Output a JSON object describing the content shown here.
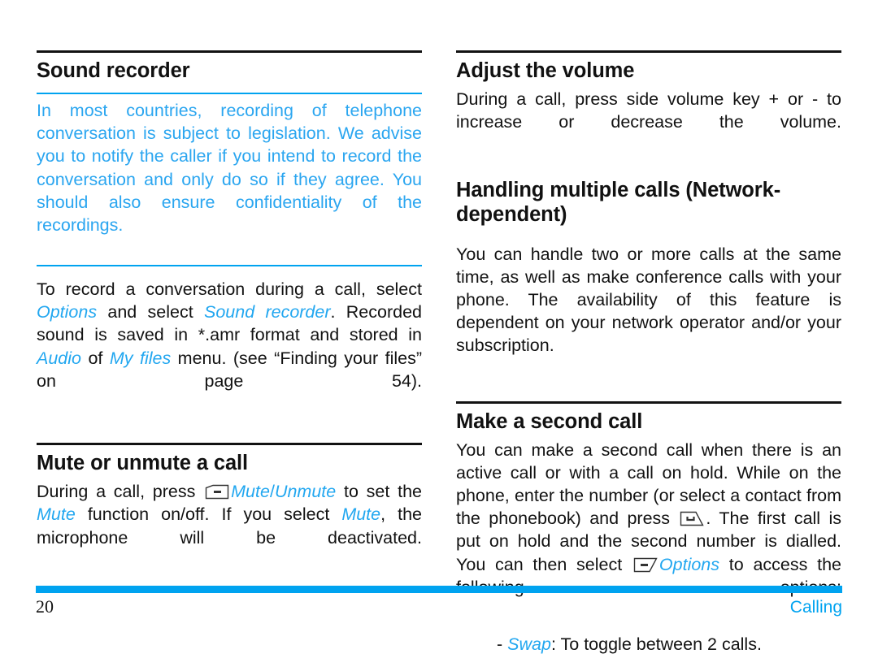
{
  "document": {
    "page_number": "20",
    "chapter": "Calling",
    "accent_color": "#00A3F0",
    "text_color": "#121212"
  },
  "left_column": {
    "section_sound_recorder": {
      "heading": "Sound recorder",
      "note": {
        "line": "In most countries, recording of telephone conversation is subject to legislation. We advise you to notify the caller if you intend to record the conversation and only do so if they agree. You should also ensure confidentiality of the recordings."
      },
      "body": {
        "p1_a": "To record a conversation during a call, select ",
        "p1_link_options": "Options",
        "p1_b": " and select ",
        "p1_link_sound_recorder": "Sound recorder",
        "p1_c": ". Recorded sound is saved in *.amr format and stored in ",
        "p1_link_audio": "Audio",
        "p1_d": " of ",
        "p1_link_myfiles": "My files",
        "p1_e": " menu. (see “Finding your files” on page 54)."
      }
    },
    "section_mute": {
      "heading": "Mute or unmute a call",
      "body": {
        "p1_a": "During a call, press ",
        "icon_left_softkey": "left-softkey-icon",
        "p1_link_mute": "Mute",
        "p1_slash": "/",
        "p1_link_unmute": "Unmute",
        "p1_b": " to set the ",
        "p1_link_mute2": "Mute",
        "p1_c": " function on/off. If you select ",
        "p1_link_mute3": "Mute",
        "p1_d": ", the microphone will be deactivated."
      }
    }
  },
  "right_column": {
    "section_volume": {
      "heading": "Adjust the volume",
      "body": "During a call, press side volume key + or - to increase or decrease the volume."
    },
    "section_multiple_calls": {
      "heading": "Handling multiple calls (Network-dependent)",
      "body": "You can handle two or more calls at the same time, as well as make conference calls with your phone. The availability of this feature is dependent on your network operator and/or your subscription."
    },
    "section_second_call": {
      "heading": "Make a second call",
      "body": {
        "p1_a": "You can make a second call when there is an active call or with a call on hold. While on the phone, enter the number (or select a contact from the phonebook) and press ",
        "icon_call_key": "call-key-icon",
        "p1_b": ". The first call is put on hold and the second number is dialled. You can then select ",
        "icon_right_softkey": "right-softkey-icon",
        "p1_link_options": "Options",
        "p1_c": " to access the following options:"
      },
      "bullet": {
        "dash": "-",
        "term": "Swap",
        "colon": ":",
        "text": " To toggle between 2 calls."
      }
    }
  }
}
